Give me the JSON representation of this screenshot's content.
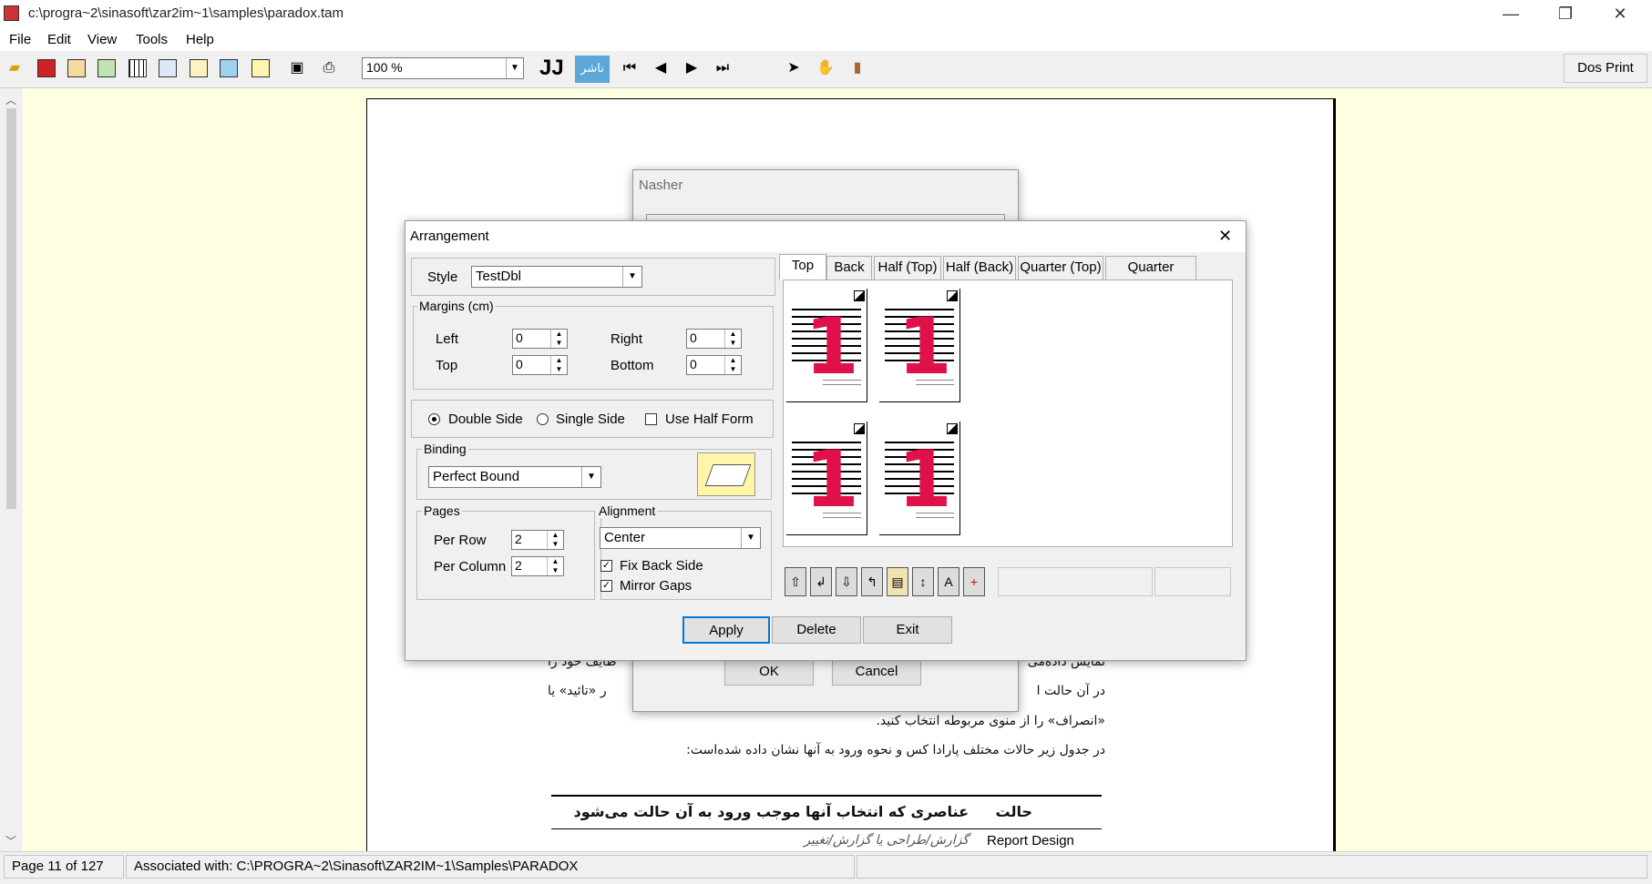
{
  "window": {
    "title": "c:\\progra~2\\sinasoft\\zar2im~1\\samples\\paradox.tam",
    "app_icon": "app-icon",
    "minimize": "—",
    "maximize": "❐",
    "close": "✕"
  },
  "menu": [
    "File",
    "Edit",
    "View",
    "Tools",
    "Help"
  ],
  "toolbar": {
    "zoom_value": "100 %",
    "dos_print": "Dos Print",
    "brand_text": "ناشر"
  },
  "document": {
    "lines": [
      "نمایش داده‌می",
      "طایف خود را",
      "در آن حالت ا",
      "ر «تائید» یا",
      "«انصراف» را از منوی مربوطه انتخاب کنید.",
      "در جدول زیر حالات مختلف پارادا کس و نحوه ورود به آنها نشان داده شده‌است:"
    ],
    "table_header": [
      "حالت",
      "عناصری که انتخاب آنها موجب ورود به آن حالت می‌شود"
    ],
    "table_row": [
      "Report Design",
      "گزارش/طراحی یا گزارش/تغییر"
    ]
  },
  "nasher_dialog": {
    "title": "Nasher",
    "ok": "OK",
    "cancel": "Cancel"
  },
  "arrangement": {
    "title": "Arrangement",
    "style_label": "Style",
    "style_value": "TestDbl",
    "margins_group": "Margins (cm)",
    "left_label": "Left",
    "left_value": "0",
    "right_label": "Right",
    "right_value": "0",
    "top_label": "Top",
    "top_value": "0",
    "bottom_label": "Bottom",
    "bottom_value": "0",
    "double_side": "Double Side",
    "single_side": "Single Side",
    "use_half_form": "Use Half Form",
    "binding_group": "Binding",
    "binding_value": "Perfect Bound",
    "pages_group": "Pages",
    "per_row_label": "Per Row",
    "per_row_value": "2",
    "per_column_label": "Per Column",
    "per_column_value": "2",
    "alignment_group": "Alignment",
    "alignment_value": "Center",
    "fix_back_side": "Fix Back Side",
    "mirror_gaps": "Mirror Gaps",
    "tabs": [
      "Top",
      "Back",
      "Half (Top)",
      "Half (Back)",
      "Quarter (Top)",
      "Quarter (Back)"
    ],
    "preview_digit": "1",
    "apply": "Apply",
    "delete": "Delete",
    "exit": "Exit",
    "close": "✕"
  },
  "statusbar": {
    "page": "Page 11 of 127",
    "associated": "Associated with: C:\\PROGRA~2\\Sinasoft\\ZAR2IM~1\\Samples\\PARADOX"
  },
  "colors": {
    "workspace": "#ffffe1",
    "preview_digit": "#e0114a"
  }
}
